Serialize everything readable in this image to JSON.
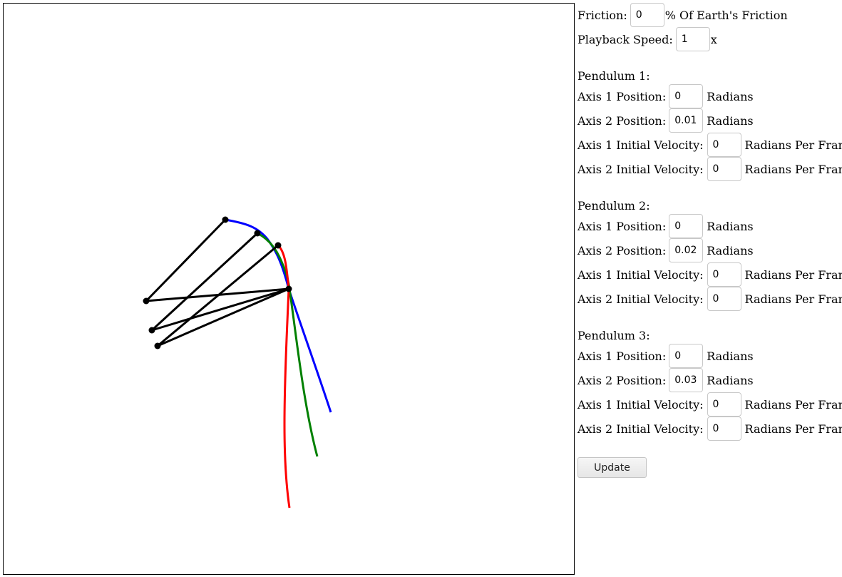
{
  "settings": {
    "friction_label": "Friction:",
    "friction_value": "0",
    "friction_unit": "% Of Earth's Friction",
    "speed_label": "Playback Speed:",
    "speed_value": "1",
    "speed_unit": "x"
  },
  "pendulums": [
    {
      "heading": "Pendulum 1:",
      "color": "#0000ff",
      "axis1_position_label": "Axis 1 Position:",
      "axis1_position": "0",
      "axis1_position_unit": "Radians",
      "axis2_position_label": "Axis 2 Position:",
      "axis2_position": "0.01",
      "axis2_position_unit": "Radians",
      "axis1_velocity_label": "Axis 1 Initial Velocity:",
      "axis1_velocity": "0",
      "axis1_velocity_unit": "Radians Per Frame",
      "axis2_velocity_label": "Axis 2 Initial Velocity:",
      "axis2_velocity": "0",
      "axis2_velocity_unit": "Radians Per Frame"
    },
    {
      "heading": "Pendulum 2:",
      "color": "#008000",
      "axis1_position_label": "Axis 1 Position:",
      "axis1_position": "0",
      "axis1_position_unit": "Radians",
      "axis2_position_label": "Axis 2 Position:",
      "axis2_position": "0.02",
      "axis2_position_unit": "Radians",
      "axis1_velocity_label": "Axis 1 Initial Velocity:",
      "axis1_velocity": "0",
      "axis1_velocity_unit": "Radians Per Frame",
      "axis2_velocity_label": "Axis 2 Initial Velocity:",
      "axis2_velocity": "0",
      "axis2_velocity_unit": "Radians Per Frame"
    },
    {
      "heading": "Pendulum 3:",
      "color": "#ff0000",
      "axis1_position_label": "Axis 1 Position:",
      "axis1_position": "0",
      "axis1_position_unit": "Radians",
      "axis2_position_label": "Axis 2 Position:",
      "axis2_position": "0.03",
      "axis2_position_unit": "Radians",
      "axis1_velocity_label": "Axis 1 Initial Velocity:",
      "axis1_velocity": "0",
      "axis1_velocity_unit": "Radians Per Frame",
      "axis2_velocity_label": "Axis 2 Initial Velocity:",
      "axis2_velocity": "0",
      "axis2_velocity_unit": "Radians Per Frame"
    }
  ],
  "update_button": "Update",
  "colors": {
    "rod": "#000000",
    "joint": "#000000",
    "canvas_border": "#000000"
  }
}
